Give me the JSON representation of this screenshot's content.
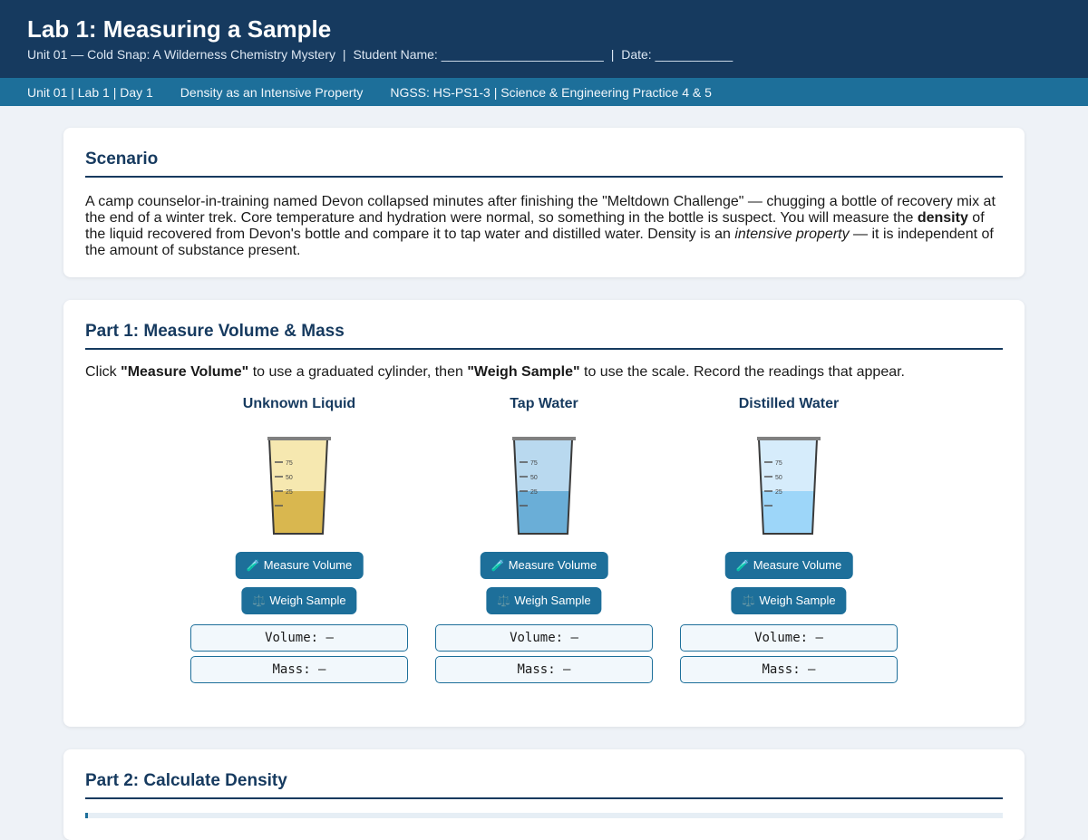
{
  "header": {
    "title": "Lab 1: Measuring a Sample",
    "unit": "Unit 01 — Cold Snap: A Wilderness Chemistry Mystery",
    "student_label": "Student Name: _______________________",
    "date_label": "Date: ___________",
    "sep": "|"
  },
  "subnav": {
    "lesson": "Unit 01 | Lab 1 | Day 1",
    "topic": "Density as an Intensive Property",
    "standards": "NGSS: HS-PS1-3 | Science & Engineering Practice 4 & 5"
  },
  "scenario": {
    "title": "Scenario",
    "text_1": "A camp counselor-in-training named Devon collapsed minutes after finishing the \"Meltdown Challenge\" — chugging a bottle of recovery mix at the end of a winter trek. Core temperature and hydration were normal, so something in the bottle is suspect. You will measure the ",
    "bold": "density",
    "text_2": " of the liquid recovered from Devon's bottle and compare it to tap water and distilled water. Density is an ",
    "italic": "intensive property",
    "text_3": " — it is independent of the amount of substance present."
  },
  "part1": {
    "title": "Part 1: Measure Volume & Mass",
    "instr_1": "Click ",
    "instr_b1": "\"Measure Volume\"",
    "instr_2": " to use a graduated cylinder, then ",
    "instr_b2": "\"Weigh Sample\"",
    "instr_3": " to use the scale. Record the readings that appear.",
    "ticks": [
      "75",
      "50",
      "25"
    ],
    "measure_label": "Measure Volume",
    "weigh_label": "Weigh Sample",
    "measure_icon": "🧪",
    "weigh_icon": "⚖️",
    "samples": [
      {
        "name": "Unknown Liquid",
        "volume": "Volume: —",
        "mass": "Mass: —",
        "top_color": "#f6e8b0",
        "liquid_color": "#d9b74f"
      },
      {
        "name": "Tap Water",
        "volume": "Volume: —",
        "mass": "Mass: —",
        "top_color": "#b9d9ef",
        "liquid_color": "#6aaed7"
      },
      {
        "name": "Distilled Water",
        "volume": "Volume: —",
        "mass": "Mass: —",
        "top_color": "#d6ecfb",
        "liquid_color": "#9dd6f9"
      }
    ]
  },
  "part2": {
    "title": "Part 2: Calculate Density"
  }
}
